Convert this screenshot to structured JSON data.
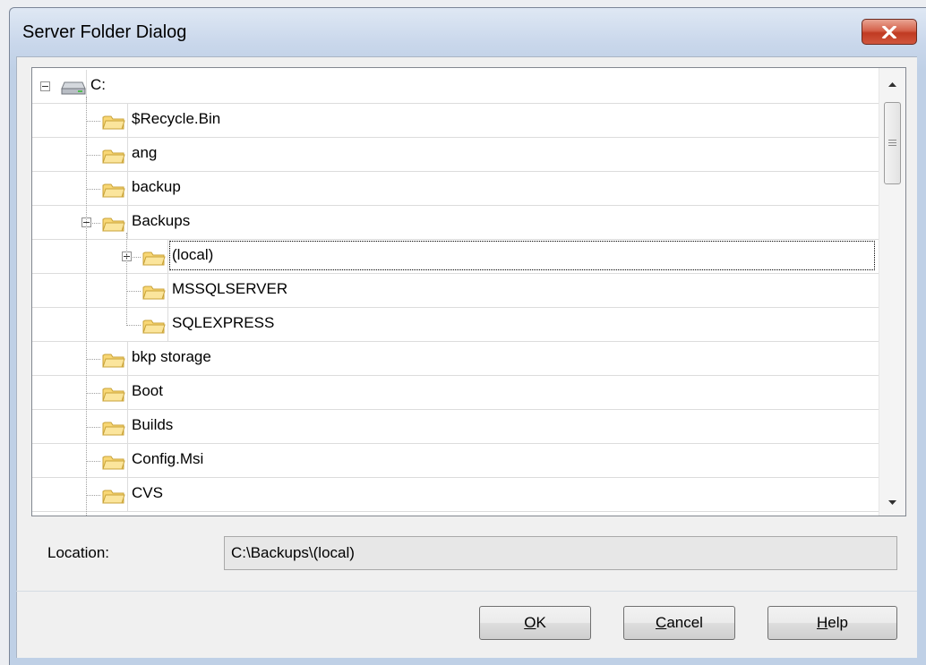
{
  "window": {
    "title": "Server Folder Dialog"
  },
  "tree": {
    "nodes": [
      {
        "label": "C:",
        "icon": "drive-icon",
        "expander": "minus"
      },
      {
        "label": "$Recycle.Bin",
        "icon": "folder-icon"
      },
      {
        "label": "ang",
        "icon": "folder-icon"
      },
      {
        "label": "backup",
        "icon": "folder-icon"
      },
      {
        "label": "Backups",
        "icon": "folder-icon",
        "expander": "minus"
      },
      {
        "label": "(local)",
        "icon": "folder-icon",
        "expander": "plus",
        "selected": true
      },
      {
        "label": "MSSQLSERVER",
        "icon": "folder-icon"
      },
      {
        "label": "SQLEXPRESS",
        "icon": "folder-icon"
      },
      {
        "label": "bkp storage",
        "icon": "folder-icon"
      },
      {
        "label": "Boot",
        "icon": "folder-icon"
      },
      {
        "label": "Builds",
        "icon": "folder-icon"
      },
      {
        "label": "Config.Msi",
        "icon": "folder-icon"
      },
      {
        "label": "CVS",
        "icon": "folder-icon"
      }
    ]
  },
  "location": {
    "label": "Location:",
    "value": "C:\\Backups\\(local)"
  },
  "buttons": {
    "ok": {
      "label": "OK",
      "accel": "O"
    },
    "cancel": {
      "label": "Cancel",
      "accel": "C"
    },
    "help": {
      "label": "Help",
      "accel": "H"
    }
  },
  "colors": {
    "close_button": "#c74a33",
    "folder_fill": "#f8d775",
    "folder_stroke": "#c8a237"
  }
}
